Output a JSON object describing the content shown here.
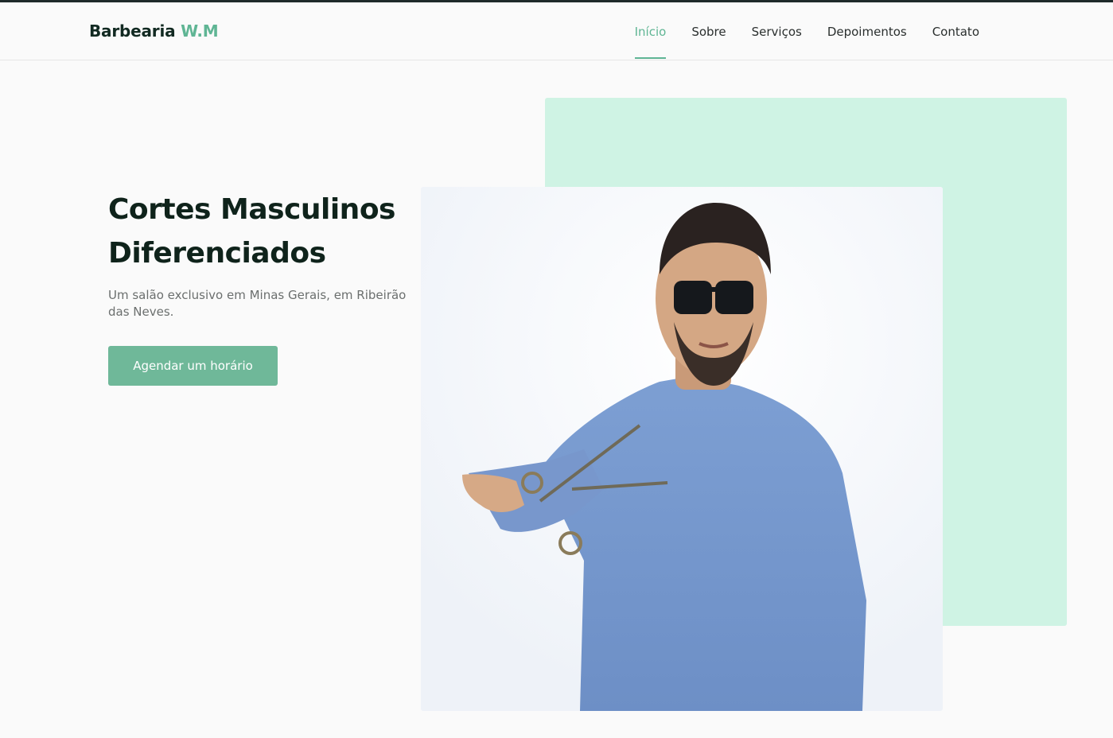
{
  "brand": {
    "name": "Barbearia",
    "accent": "W.M",
    "accent_color": "#5fb594"
  },
  "nav": {
    "items": [
      {
        "label": "Início",
        "active": true
      },
      {
        "label": "Sobre"
      },
      {
        "label": "Serviços"
      },
      {
        "label": "Depoimentos"
      },
      {
        "label": "Contato"
      }
    ]
  },
  "hero": {
    "title_line1": "Cortes Masculinos",
    "title_line2": "Diferenciados",
    "subtitle": "Um salão exclusivo em Minas Gerais, em Ribeirão das Neves.",
    "cta_label": "Agendar um horário"
  },
  "colors": {
    "mint": "#cff3e4",
    "button": "#6fb899",
    "title": "#0f231b"
  },
  "icons": [
    "scissors-icon",
    "sunglasses-icon"
  ]
}
